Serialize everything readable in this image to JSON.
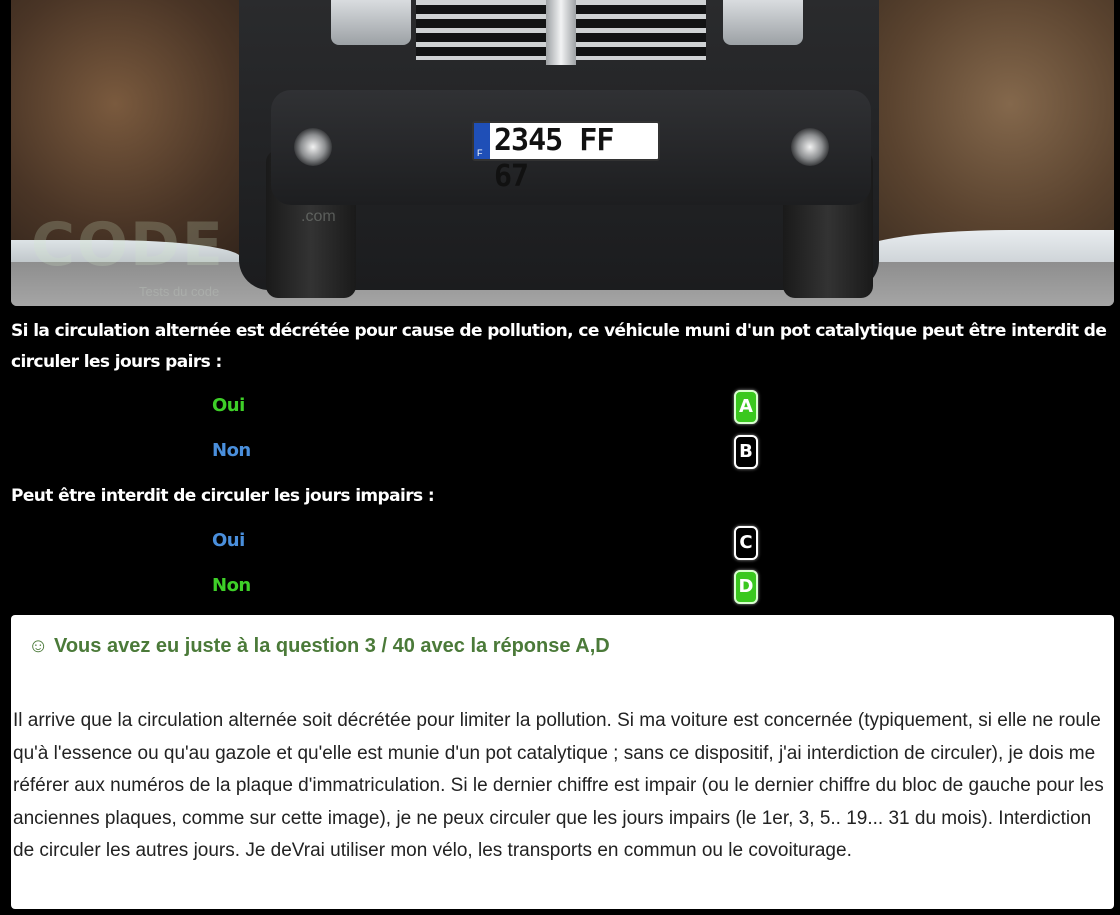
{
  "image": {
    "plate_text": "2345 FF 67",
    "plate_eu_letter": "F",
    "watermark": "CODE",
    "watermark_suffix": ".com",
    "watermark_sub": "Tests du code"
  },
  "question1": {
    "text": "Si la circulation alternée est décrétée pour cause de pollution, ce véhicule muni d'un pot catalytique peut être interdit de circuler les jours pairs :",
    "answers": [
      {
        "label": "Oui",
        "letter": "A",
        "status": "correct"
      },
      {
        "label": "Non",
        "letter": "B",
        "status": "neutral"
      }
    ]
  },
  "question2": {
    "text": "Peut être interdit de circuler les jours impairs :",
    "answers": [
      {
        "label": "Oui",
        "letter": "C",
        "status": "neutral"
      },
      {
        "label": "Non",
        "letter": "D",
        "status": "correct"
      }
    ]
  },
  "result": {
    "title": "☺ Vous avez eu juste à la question 3 / 40 avec la réponse A,D",
    "explanation": "Il arrive que la circulation alternée soit décrétée pour limiter la pollution. Si ma voiture est concernée (typiquement, si elle ne roule qu'à l'essence ou qu'au gazole et qu'elle est munie d'un pot catalytique ; sans ce dispositif, j'ai interdiction de circuler), je dois me référer aux numéros de la plaque d'immatriculation. Si le dernier chiffre est impair (ou le dernier chiffre du bloc de gauche pour les anciennes plaques, comme sur cette image), je ne peux circuler que les jours impairs (le 1er, 3, 5.. 19... 31 du mois). Interdiction de circuler les autres jours. Je deVrai utiliser mon vélo, les transports en commun ou le covoiturage."
  },
  "colors": {
    "correct_answer": "#3ecf28",
    "wrong_answer": "#4a8fdc",
    "result_title": "#4b7a39",
    "background": "#000000"
  }
}
